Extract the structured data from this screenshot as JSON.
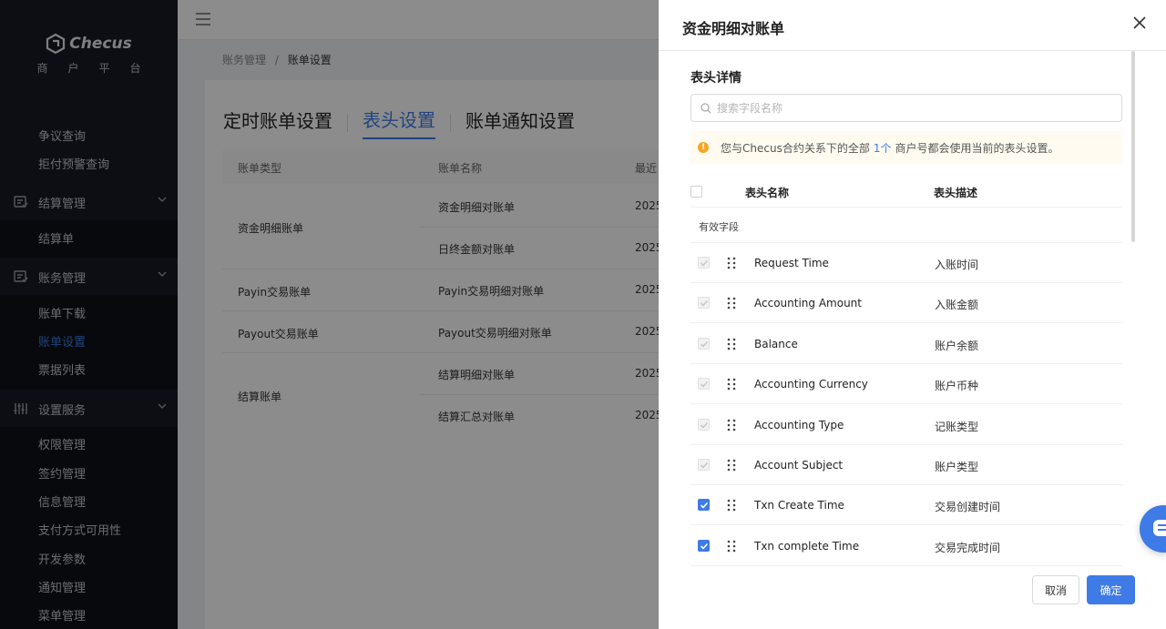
{
  "sidebar": {
    "brand": "Checus",
    "brand_sub": "商户平台",
    "items": {
      "dispute": "争议查询",
      "chargeback": "拒付预警查询",
      "settlement_group": "结算管理",
      "settlement_list": "结算单",
      "account_group": "账务管理",
      "bill_download": "账单下载",
      "bill_settings": "账单设置",
      "invoice_list": "票据列表",
      "service_group": "设置服务",
      "permission": "权限管理",
      "contract": "签约管理",
      "info": "信息管理",
      "payment_availability": "支付方式可用性",
      "dev_params": "开发参数",
      "notify": "通知管理",
      "menu": "菜单管理"
    }
  },
  "breadcrumb": {
    "parent": "账务管理",
    "separator": "/",
    "current": "账单设置"
  },
  "tabs": {
    "scheduled": "定时账单设置",
    "header": "表头设置",
    "notify": "账单通知设置"
  },
  "table": {
    "columns": [
      "账单类型",
      "账单名称",
      "最近"
    ],
    "types": [
      "资金明细账单",
      "Payin交易账单",
      "Payout交易账单",
      "结算账单"
    ],
    "rows": [
      {
        "name": "资金明细对账单",
        "date": "2025"
      },
      {
        "name": "日终金额对账单",
        "date": "2025"
      },
      {
        "name": "Payin交易明细对账单",
        "date": "2025"
      },
      {
        "name": "Payout交易明细对账单",
        "date": "2025"
      },
      {
        "name": "结算明细对账单",
        "date": "2025"
      },
      {
        "name": "结算汇总对账单",
        "date": "2025"
      }
    ]
  },
  "drawer": {
    "title": "资金明细对账单",
    "section_title": "表头详情",
    "search_placeholder": "搜索字段名称",
    "notice_prefix": "您与Checus合约关系下的全部",
    "notice_link": "1个",
    "notice_suffix": "商户号都会使用当前的表头设置。",
    "col_name": "表头名称",
    "col_desc": "表头描述",
    "group_label": "有效字段",
    "fields": [
      {
        "name": "Request Time",
        "desc": "入账时间",
        "state": "disabled"
      },
      {
        "name": "Accounting Amount",
        "desc": "入账金额",
        "state": "disabled"
      },
      {
        "name": "Balance",
        "desc": "账户余额",
        "state": "disabled"
      },
      {
        "name": "Accounting Currency",
        "desc": "账户币种",
        "state": "disabled"
      },
      {
        "name": "Accounting Type",
        "desc": "记账类型",
        "state": "disabled"
      },
      {
        "name": "Account Subject",
        "desc": "账户类型",
        "state": "disabled"
      },
      {
        "name": "Txn Create Time",
        "desc": "交易创建时间",
        "state": "checked"
      },
      {
        "name": "Txn complete Time",
        "desc": "交易完成时间",
        "state": "checked"
      }
    ],
    "cancel_label": "取消",
    "ok_label": "确定"
  },
  "colors": {
    "accent": "#3e7be6",
    "sidebar_bg": "#191a23",
    "warning": "#f5a623"
  }
}
